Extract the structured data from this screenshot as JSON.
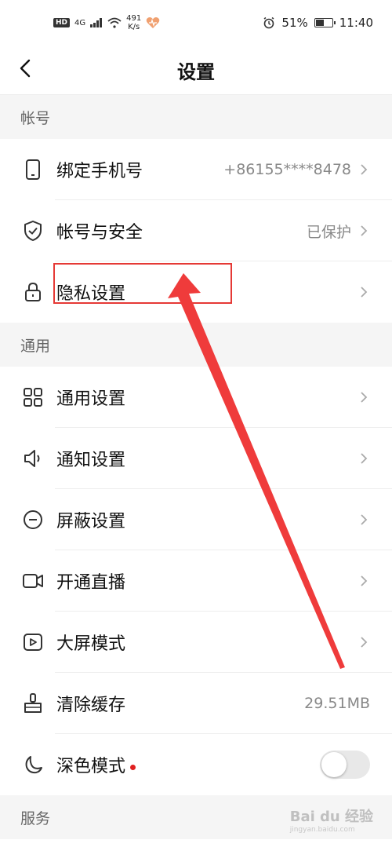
{
  "status_bar": {
    "hd": "HD",
    "network": "4G",
    "net_speed_value": "491",
    "net_speed_unit": "K/s",
    "battery_percent": "51%",
    "battery_level": 0.51,
    "time": "11:40"
  },
  "header": {
    "title": "设置"
  },
  "sections": {
    "account": {
      "label": "帐号"
    },
    "general": {
      "label": "通用"
    },
    "service": {
      "label": "服务"
    }
  },
  "account_items": [
    {
      "label": "绑定手机号",
      "value": "+86155****8478"
    },
    {
      "label": "帐号与安全",
      "value": "已保护"
    },
    {
      "label": "隐私设置",
      "value": ""
    }
  ],
  "general_items": [
    {
      "label": "通用设置"
    },
    {
      "label": "通知设置"
    },
    {
      "label": "屏蔽设置"
    },
    {
      "label": "开通直播"
    },
    {
      "label": "大屏模式"
    },
    {
      "label": "清除缓存",
      "value": "29.51MB"
    },
    {
      "label": "深色模式",
      "toggle_on": false
    }
  ],
  "watermark": {
    "text": "Bai du 经验",
    "sub": "jingyan.baidu.com"
  },
  "colors": {
    "annotation_red": "#e53935",
    "red_dot": "#e02020"
  }
}
